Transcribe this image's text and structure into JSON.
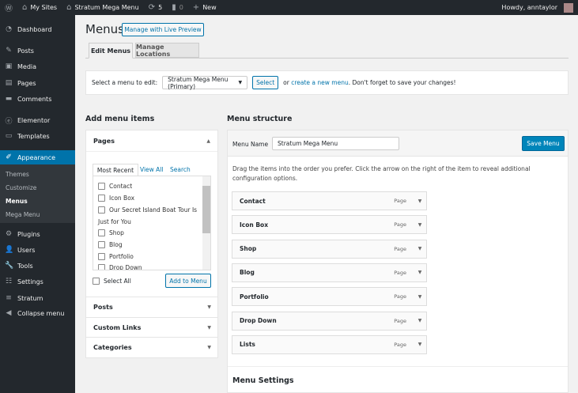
{
  "admin_bar": {
    "site_menu": "My Sites",
    "site_name": "Stratum Mega Menu",
    "updates": "5",
    "comments": "0",
    "new": "New",
    "howdy": "Howdy, anntaylor"
  },
  "sidebar": {
    "items": [
      {
        "label": "Dashboard",
        "icon": "dashboard-icon"
      },
      {
        "label": "Posts",
        "icon": "pin-icon"
      },
      {
        "label": "Media",
        "icon": "media-icon"
      },
      {
        "label": "Pages",
        "icon": "pages-icon"
      },
      {
        "label": "Comments",
        "icon": "comment-icon"
      },
      {
        "label": "Elementor",
        "icon": "elementor-icon"
      },
      {
        "label": "Templates",
        "icon": "folder-icon"
      },
      {
        "label": "Appearance",
        "icon": "brush-icon"
      },
      {
        "label": "Plugins",
        "icon": "plugin-icon"
      },
      {
        "label": "Users",
        "icon": "users-icon"
      },
      {
        "label": "Tools",
        "icon": "wrench-icon"
      },
      {
        "label": "Settings",
        "icon": "settings-icon"
      },
      {
        "label": "Stratum",
        "icon": "stratum-icon"
      },
      {
        "label": "Collapse menu",
        "icon": "collapse-icon"
      }
    ],
    "submenu": [
      "Themes",
      "Customize",
      "Menus",
      "Mega Menu"
    ]
  },
  "page": {
    "title": "Menus",
    "live_preview": "Manage with Live Preview",
    "tabs": [
      "Edit Menus",
      "Manage Locations"
    ]
  },
  "select_bar": {
    "label": "Select a menu to edit:",
    "selected": "Stratum Mega Menu (Primary)",
    "select_btn": "Select",
    "or": "or",
    "create_link": "create a new menu",
    "suffix": ". Don't forget to save your changes!"
  },
  "add_items": {
    "title": "Add menu items",
    "pages_title": "Pages",
    "tabs": [
      "Most Recent",
      "View All",
      "Search"
    ],
    "pages": [
      "Contact",
      "Icon Box",
      "Our Secret Island Boat Tour Is",
      "Just for You",
      "Shop",
      "Blog",
      "Portfolio",
      "Drop Down"
    ],
    "select_all": "Select All",
    "add_btn": "Add to Menu",
    "sections": [
      "Posts",
      "Custom Links",
      "Categories"
    ]
  },
  "structure": {
    "title": "Menu structure",
    "name_label": "Menu Name",
    "name_value": "Stratum Mega Menu",
    "save": "Save Menu",
    "instructions": "Drag the items into the order you prefer. Click the arrow on the right of the item to reveal additional configuration options.",
    "items": [
      {
        "title": "Contact",
        "type": "Page"
      },
      {
        "title": "Icon Box",
        "type": "Page"
      },
      {
        "title": "Shop",
        "type": "Page"
      },
      {
        "title": "Blog",
        "type": "Page"
      },
      {
        "title": "Portfolio",
        "type": "Page"
      },
      {
        "title": "Drop Down",
        "type": "Page"
      },
      {
        "title": "Lists",
        "type": "Page"
      }
    ],
    "settings_title": "Menu Settings"
  }
}
